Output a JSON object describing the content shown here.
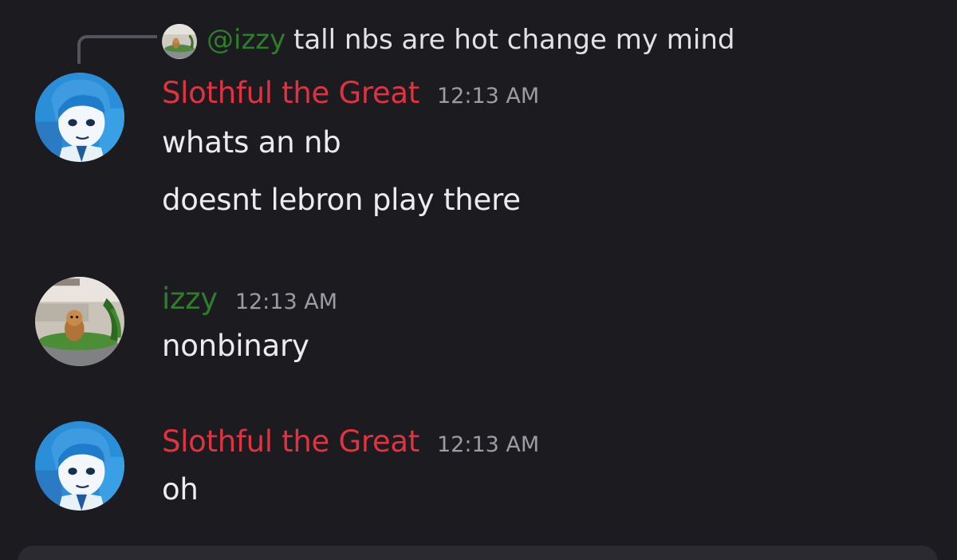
{
  "reply": {
    "mention": "@izzy",
    "text": "tall nbs are hot change my mind",
    "avatar_icon": "dog-in-tub-icon"
  },
  "messages": [
    {
      "username": "Slothful the Great",
      "username_color": "#e0323f",
      "timestamp": "12:13 AM",
      "avatar_icon": "anime-boy-avatar-icon",
      "lines": [
        "whats an nb",
        "doesnt lebron play there"
      ]
    },
    {
      "username": "izzy",
      "username_color": "#2e7d2a",
      "timestamp": "12:13 AM",
      "avatar_icon": "dog-in-tub-icon",
      "lines": [
        "nonbinary"
      ]
    },
    {
      "username": "Slothful the Great",
      "username_color": "#e0323f",
      "timestamp": "12:13 AM",
      "avatar_icon": "anime-boy-avatar-icon",
      "lines": [
        "oh"
      ]
    }
  ],
  "colors": {
    "background": "#1c1b20",
    "text": "#ececef",
    "timestamp": "#9d9ca3",
    "composer": "#2b2a31"
  }
}
